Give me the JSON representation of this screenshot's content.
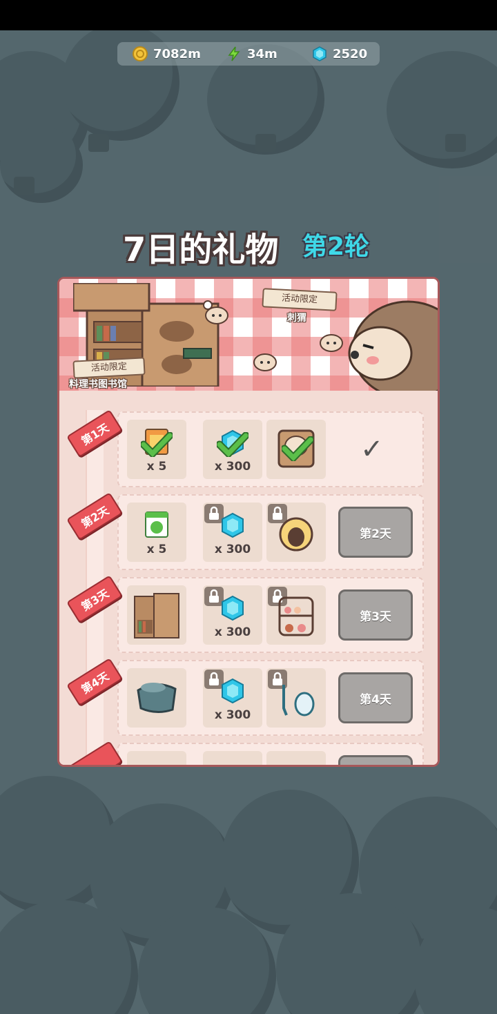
{
  "resources": {
    "coins": "7082m",
    "energy": "34m",
    "gems": "2520"
  },
  "title": {
    "main": "7日的礼物",
    "round": "第2轮"
  },
  "banner": {
    "tag_left": "活动限定",
    "tag_left_sub": "料理书图书馆",
    "tag_right": "活动限定",
    "tag_right_sub": "刺猬"
  },
  "days": [
    {
      "tag": "第1天",
      "rewards": [
        {
          "icon": "ticket-icon",
          "qty": "x 5",
          "claimed": true,
          "locked": false
        },
        {
          "icon": "gem-icon",
          "qty": "x 300",
          "claimed": true,
          "locked": false
        },
        {
          "icon": "costume-icon",
          "qty": "",
          "claimed": true,
          "locked": false
        }
      ],
      "status": "claimed",
      "status_mark": "✓"
    },
    {
      "tag": "第2天",
      "rewards": [
        {
          "icon": "green-ticket-icon",
          "qty": "x 5",
          "claimed": false,
          "locked": false
        },
        {
          "icon": "gem-icon",
          "qty": "x 300",
          "claimed": false,
          "locked": true
        },
        {
          "icon": "chick-hat-icon",
          "qty": "",
          "claimed": false,
          "locked": true
        }
      ],
      "status": "pending",
      "button_label": "第2天"
    },
    {
      "tag": "第3天",
      "rewards": [
        {
          "icon": "bookshelf-icon",
          "qty": "",
          "claimed": false,
          "locked": false
        },
        {
          "icon": "gem-icon",
          "qty": "x 300",
          "claimed": false,
          "locked": true
        },
        {
          "icon": "dessert-stand-icon",
          "qty": "",
          "claimed": false,
          "locked": true
        }
      ],
      "status": "pending",
      "button_label": "第3天"
    },
    {
      "tag": "第4天",
      "rewards": [
        {
          "icon": "cushion-icon",
          "qty": "",
          "claimed": false,
          "locked": false
        },
        {
          "icon": "gem-icon",
          "qty": "x 300",
          "claimed": false,
          "locked": true
        },
        {
          "icon": "glove-icon",
          "qty": "",
          "claimed": false,
          "locked": true
        }
      ],
      "status": "pending",
      "button_label": "第4天"
    }
  ],
  "colors": {
    "accent_round": "#3fd9e8",
    "day_tag": "#e9545a",
    "panel_border": "#a7585a",
    "check_green": "#5bbf4a",
    "gem_cyan": "#2fc6e8"
  }
}
